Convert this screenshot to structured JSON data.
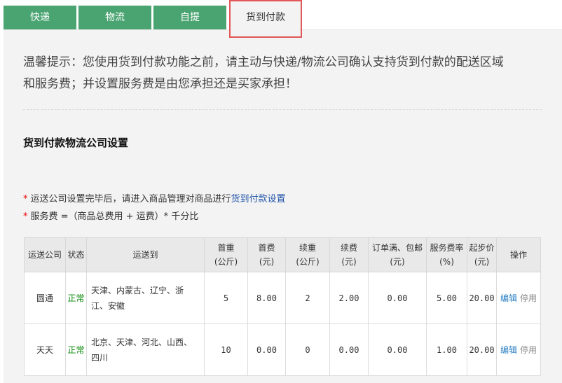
{
  "tabs": [
    {
      "label": "快递"
    },
    {
      "label": "物流"
    },
    {
      "label": "自提"
    },
    {
      "label": "货到付款",
      "active": true
    }
  ],
  "tip": {
    "line1": "温馨提示：您使用货到付款功能之前，请主动与快递/物流公司确认支持货到付款的配送区域",
    "line2": "和服务费；并设置服务费是由您承担还是买家承担！"
  },
  "section": {
    "title": "货到付款物流公司设置",
    "note1_prefix": "运送公司设置完毕后，请进入商品管理对商品进行",
    "note1_link": "货到付款设置",
    "note2": "服务费 =（商品总费用 + 运费）* 千分比",
    "required_mark": "*"
  },
  "table": {
    "headers": [
      [
        "运送公司"
      ],
      [
        "状态"
      ],
      [
        "运送到"
      ],
      [
        "首重",
        "(公斤)"
      ],
      [
        "首费",
        "(元)"
      ],
      [
        "续重",
        "(公斤)"
      ],
      [
        "续费",
        "(元)"
      ],
      [
        "订单满、包邮",
        "(元)"
      ],
      [
        "服务费率",
        "(%)"
      ],
      [
        "起步价",
        "(元)"
      ],
      [
        "操作"
      ]
    ],
    "rows": [
      {
        "company": "圆通",
        "status": "正常",
        "dest_line1": "天津、内蒙古、辽宁、浙",
        "dest_line2": "江、安徽",
        "first_weight": "5",
        "first_fee": "8.00",
        "extra_weight": "2",
        "extra_fee": "2.00",
        "free_over": "0.00",
        "service_rate": "5.00",
        "min_price": "20.00",
        "edit": "编辑",
        "disable": "停用"
      },
      {
        "company": "天天",
        "status": "正常",
        "dest_line1": "北京、天津、河北、山西、",
        "dest_line2": "四川",
        "first_weight": "10",
        "first_fee": "0.00",
        "extra_weight": "0",
        "extra_fee": "0.00",
        "free_over": "0.00",
        "service_rate": "1.00",
        "min_price": "20.00",
        "edit": "编辑",
        "disable": "停用"
      }
    ]
  },
  "colors": {
    "tab_green": "#4aa471",
    "highlight_red": "#e25757",
    "status_green": "#0a8a0a",
    "link_blue": "#2a7fc4"
  }
}
